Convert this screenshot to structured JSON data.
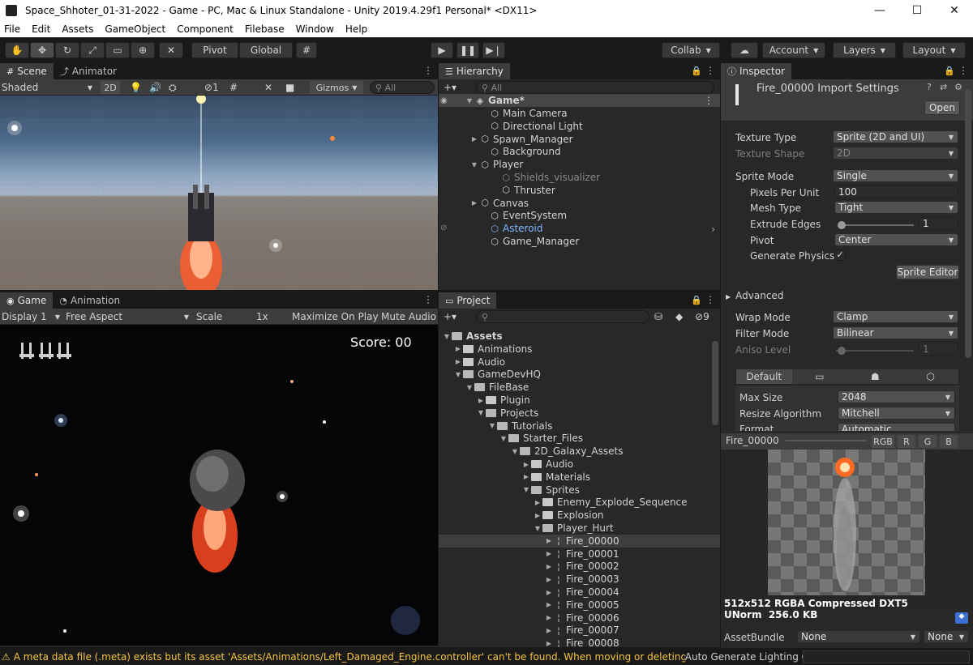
{
  "window": {
    "title": "Space_Shhoter_01-31-2022 - Game - PC, Mac & Linux Standalone - Unity 2019.4.29f1 Personal* <DX11>",
    "minimize": "—",
    "maximize": "☐",
    "close": "✕"
  },
  "menu": [
    "File",
    "Edit",
    "Assets",
    "GameObject",
    "Component",
    "Filebase",
    "Window",
    "Help"
  ],
  "toolbar": {
    "pivot": "Pivot",
    "global": "Global",
    "play": "▶",
    "pause": "❚❚",
    "step": "▶❘",
    "collab": "Collab",
    "account": "Account",
    "layers": "Layers",
    "layout": "Layout"
  },
  "scene": {
    "tab_scene": "Scene",
    "tab_animator": "Animator",
    "shading": "Shaded",
    "mode2d": "2D",
    "gizmos": "Gizmos",
    "search_placeholder": "All",
    "hidden_count": "1"
  },
  "game": {
    "tab_game": "Game",
    "tab_animation": "Animation",
    "display": "Display 1",
    "aspect": "Free Aspect",
    "scale_label": "Scale",
    "scale_value": "1x",
    "maximize": "Maximize On Play",
    "mute": "Mute Audio",
    "score": "Score: 00"
  },
  "hierarchy": {
    "tab": "Hierarchy",
    "search_placeholder": "All",
    "scene_name": "Game*",
    "items": [
      {
        "label": "Main Camera",
        "arrow": ""
      },
      {
        "label": "Directional Light",
        "arrow": ""
      },
      {
        "label": "Spawn_Manager",
        "arrow": "▶"
      },
      {
        "label": "Background",
        "arrow": ""
      },
      {
        "label": "Player",
        "arrow": "▼"
      },
      {
        "label": "Shields_visualizer",
        "arrow": ""
      },
      {
        "label": "Thruster",
        "arrow": ""
      },
      {
        "label": "Canvas",
        "arrow": "▶"
      },
      {
        "label": "EventSystem",
        "arrow": ""
      },
      {
        "label": "Asteroid",
        "arrow": ""
      },
      {
        "label": "Game_Manager",
        "arrow": ""
      }
    ]
  },
  "project": {
    "tab": "Project",
    "hidden_count": "9",
    "items": [
      {
        "label": "Assets",
        "arrow": "▼"
      },
      {
        "label": "Animations",
        "arrow": "▶"
      },
      {
        "label": "Audio",
        "arrow": "▶"
      },
      {
        "label": "GameDevHQ",
        "arrow": "▼"
      },
      {
        "label": "FileBase",
        "arrow": "▼"
      },
      {
        "label": "Plugin",
        "arrow": "▶"
      },
      {
        "label": "Projects",
        "arrow": "▼"
      },
      {
        "label": "Tutorials",
        "arrow": "▼"
      },
      {
        "label": "Starter_Files",
        "arrow": "▼"
      },
      {
        "label": "2D_Galaxy_Assets",
        "arrow": "▼"
      },
      {
        "label": "Audio",
        "arrow": "▶"
      },
      {
        "label": "Materials",
        "arrow": "▶"
      },
      {
        "label": "Sprites",
        "arrow": "▼"
      },
      {
        "label": "Enemy_Explode_Sequence",
        "arrow": "▶"
      },
      {
        "label": "Explosion",
        "arrow": "▶"
      },
      {
        "label": "Player_Hurt",
        "arrow": "▼"
      },
      {
        "label": "Fire_00000",
        "arrow": "▶"
      },
      {
        "label": "Fire_00001",
        "arrow": "▶"
      },
      {
        "label": "Fire_00002",
        "arrow": "▶"
      },
      {
        "label": "Fire_00003",
        "arrow": "▶"
      },
      {
        "label": "Fire_00004",
        "arrow": "▶"
      },
      {
        "label": "Fire_00005",
        "arrow": "▶"
      },
      {
        "label": "Fire_00006",
        "arrow": "▶"
      },
      {
        "label": "Fire_00007",
        "arrow": "▶"
      },
      {
        "label": "Fire_00008",
        "arrow": "▶"
      }
    ]
  },
  "inspector": {
    "tab": "Inspector",
    "title": "Fire_00000 Import Settings",
    "open": "Open",
    "texture_type_label": "Texture Type",
    "texture_type": "Sprite (2D and UI)",
    "texture_shape_label": "Texture Shape",
    "texture_shape": "2D",
    "sprite_mode_label": "Sprite Mode",
    "sprite_mode": "Single",
    "ppu_label": "Pixels Per Unit",
    "ppu": "100",
    "mesh_type_label": "Mesh Type",
    "mesh_type": "Tight",
    "extrude_label": "Extrude Edges",
    "extrude": "1",
    "pivot_label": "Pivot",
    "pivot": "Center",
    "gen_physics_label": "Generate Physics S",
    "checkmark": "✓",
    "sprite_editor": "Sprite Editor",
    "advanced": "Advanced",
    "wrap_label": "Wrap Mode",
    "wrap": "Clamp",
    "filter_label": "Filter Mode",
    "filter": "Bilinear",
    "aniso_label": "Aniso Level",
    "aniso": "1",
    "platform_default": "Default",
    "max_size_label": "Max Size",
    "max_size": "2048",
    "resize_label": "Resize Algorithm",
    "resize": "Mitchell",
    "format_label": "Format",
    "format": "Automatic",
    "preview_name": "Fire_00000",
    "ch_rgb": "RGB",
    "ch_r": "R",
    "ch_g": "G",
    "ch_b": "B",
    "preview_size": "512x512",
    "preview_format": "RGBA Compressed DXT5 UNorm",
    "preview_kb": "256.0 KB",
    "assetbundle_label": "AssetBundle",
    "assetbundle": "None",
    "variant": "None"
  },
  "status": {
    "message": "A meta data file (.meta) exists but its asset 'Assets/Animations/Left_Damaged_Engine.controller' can't be found. When moving or deleting files outside",
    "lighting": "Auto Generate Lighting Off"
  }
}
